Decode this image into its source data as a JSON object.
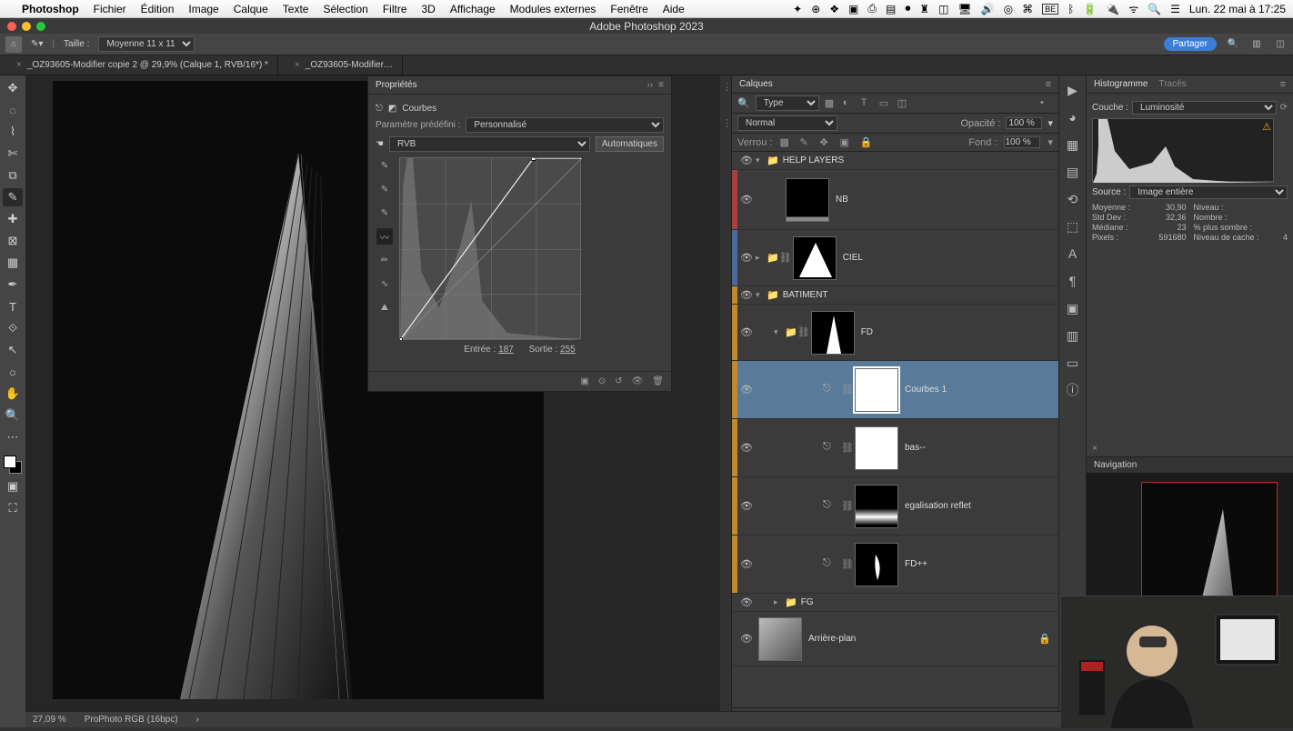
{
  "menubar": {
    "app": "Photoshop",
    "items": [
      "Fichier",
      "Édition",
      "Image",
      "Calque",
      "Texte",
      "Sélection",
      "Filtre",
      "3D",
      "Affichage",
      "Modules externes",
      "Fenêtre",
      "Aide"
    ],
    "clock": "Lun. 22 mai à 17:25"
  },
  "window": {
    "title": "Adobe Photoshop 2023"
  },
  "optionsbar": {
    "size_label": "Taille :",
    "size_value": "Moyenne 11 x 11",
    "share": "Partager"
  },
  "doc_tabs": [
    "_OZ93605-Modifier copie 2 @ 29,9% (Calque 1, RVB/16*) *",
    "_OZ93605-Modifier…"
  ],
  "statusbar": {
    "zoom": "27,09 %",
    "profile": "ProPhoto RGB (16bpc)"
  },
  "properties": {
    "panel_title": "Propriétés",
    "type": "Courbes",
    "preset_label": "Paramètre prédéfini :",
    "preset_value": "Personnalisé",
    "channel_value": "RVB",
    "auto": "Automatiques",
    "input_label": "Entrée :",
    "input_value": "187",
    "output_label": "Sortie :",
    "output_value": "255"
  },
  "layers_panel": {
    "title": "Calques",
    "filter_kind": "Type",
    "blend_mode": "Normal",
    "opacity_label": "Opacité :",
    "opacity_value": "100 %",
    "lock_label": "Verrou :",
    "fill_label": "Fond :",
    "fill_value": "100 %",
    "groups": {
      "help": "HELP LAYERS",
      "batiment": "BATIMENT"
    },
    "layers": {
      "nb": "NB",
      "ciel": "CIEL",
      "fd": "FD",
      "courbes": "Courbes 1",
      "bas": "bas--",
      "egal": "egalisation reflet",
      "fdpp": "FD++",
      "fg": "FG",
      "bg": "Arrière-plan"
    }
  },
  "histogram": {
    "tab1": "Histogramme",
    "tab2": "Tracés",
    "channel_label": "Couche :",
    "channel_value": "Luminosité",
    "source_label": "Source :",
    "source_value": "Image entière",
    "stats": {
      "mean_l": "Moyenne :",
      "mean_v": "30,90",
      "std_l": "Std Dev :",
      "std_v": "32,36",
      "med_l": "Médiane :",
      "med_v": "23",
      "px_l": "Pixels :",
      "px_v": "591680",
      "lvl_l": "Niveau :",
      "lvl_v": "",
      "cnt_l": "Nombre :",
      "cnt_v": "",
      "pct_l": "% plus sombre :",
      "pct_v": "",
      "cache_l": "Niveau de cache :",
      "cache_v": "4"
    }
  },
  "navigation": {
    "title": "Navigation"
  },
  "chart_data": {
    "type": "line",
    "title": "Courbes (RVB)",
    "xlabel": "Entrée",
    "ylabel": "Sortie",
    "xlim": [
      0,
      255
    ],
    "ylim": [
      0,
      255
    ],
    "points": [
      [
        0,
        0
      ],
      [
        187,
        255
      ],
      [
        255,
        255
      ]
    ],
    "histogram_peaks_x": [
      5,
      90
    ]
  }
}
